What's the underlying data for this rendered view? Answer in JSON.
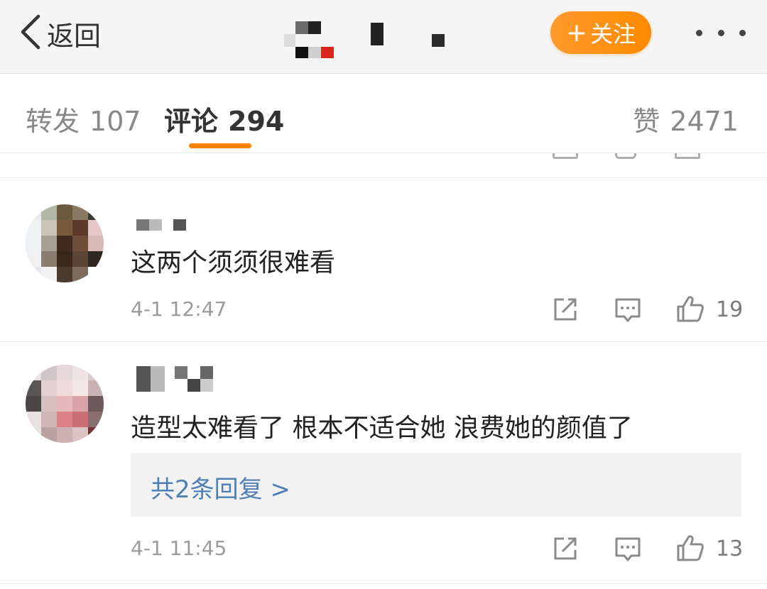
{
  "navbar": {
    "back_label": "返回",
    "follow_label": "关注",
    "follow_plus": "+",
    "accent_color": "#ff8200"
  },
  "tabs": {
    "repost": {
      "label": "转发",
      "count": "107"
    },
    "comment": {
      "label": "评论",
      "count": "294"
    },
    "likes": {
      "label": "赞",
      "count": "2471"
    }
  },
  "comments": [
    {
      "text": "这两个须须很难看",
      "time": "4-1 12:47",
      "likes": "19"
    },
    {
      "text": "造型太难看了 根本不适合她 浪费她的颜值了",
      "replies_label": "共2条回复 >",
      "time": "4-1 11:45",
      "likes": "13"
    }
  ],
  "icons": {
    "back": "chevron-left-icon",
    "more": "more-dots-icon",
    "share": "share-icon",
    "comment": "comment-icon",
    "like": "thumbs-up-icon"
  }
}
